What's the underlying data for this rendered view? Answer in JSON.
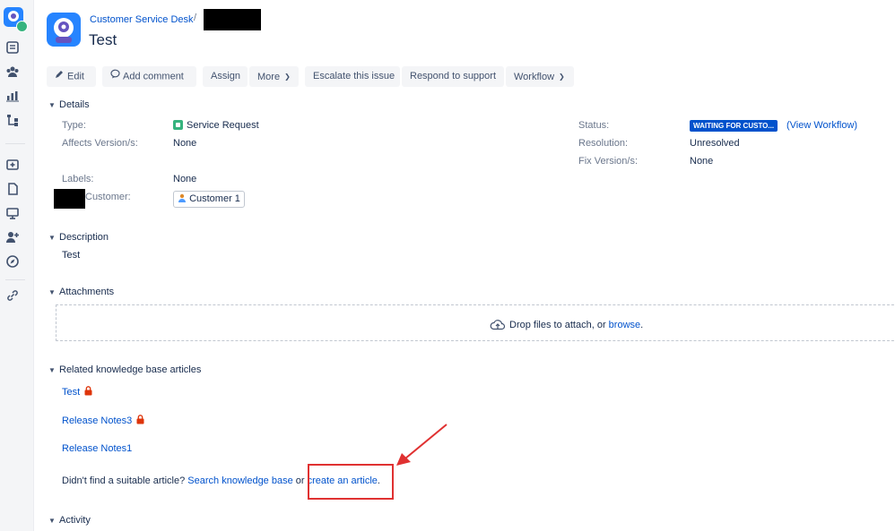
{
  "breadcrumb": {
    "project": "Customer Service Desk",
    "separator": "/"
  },
  "issue": {
    "title": "Test"
  },
  "toolbar": {
    "edit": "Edit",
    "add_comment": "Add comment",
    "assign": "Assign",
    "more": "More",
    "escalate": "Escalate this issue",
    "respond": "Respond to support",
    "workflow": "Workflow"
  },
  "details": {
    "heading": "Details",
    "type_label": "Type:",
    "type_value": "Service Request",
    "affects_label": "Affects Version/s:",
    "affects_value": "None",
    "labels_label": "Labels:",
    "labels_value": "None",
    "customer_label": "Customer:",
    "customer_value": "Customer 1",
    "status_label": "Status:",
    "status_value": "WAITING FOR CUSTO...",
    "status_link": "(View Workflow)",
    "resolution_label": "Resolution:",
    "resolution_value": "Unresolved",
    "fix_label": "Fix Version/s:",
    "fix_value": "None",
    "status_color": "#0052cc"
  },
  "description": {
    "heading": "Description",
    "text": "Test"
  },
  "attachments": {
    "heading": "Attachments",
    "drop_text": "Drop files to attach, or",
    "browse": "browse",
    "period": "."
  },
  "kb": {
    "heading": "Related knowledge base articles",
    "articles": [
      {
        "title": "Test",
        "locked": true
      },
      {
        "title": "Release Notes3",
        "locked": true
      },
      {
        "title": "Release Notes1",
        "locked": false
      }
    ],
    "prompt": "Didn't find a suitable article?",
    "search_link": "Search knowledge base",
    "or": "or",
    "create_link": "create an article",
    "period": "."
  },
  "activity": {
    "heading": "Activity"
  },
  "colors": {
    "link": "#0052cc",
    "annotation": "#e03131",
    "accent": "#2684ff",
    "lock": "#de350b"
  }
}
